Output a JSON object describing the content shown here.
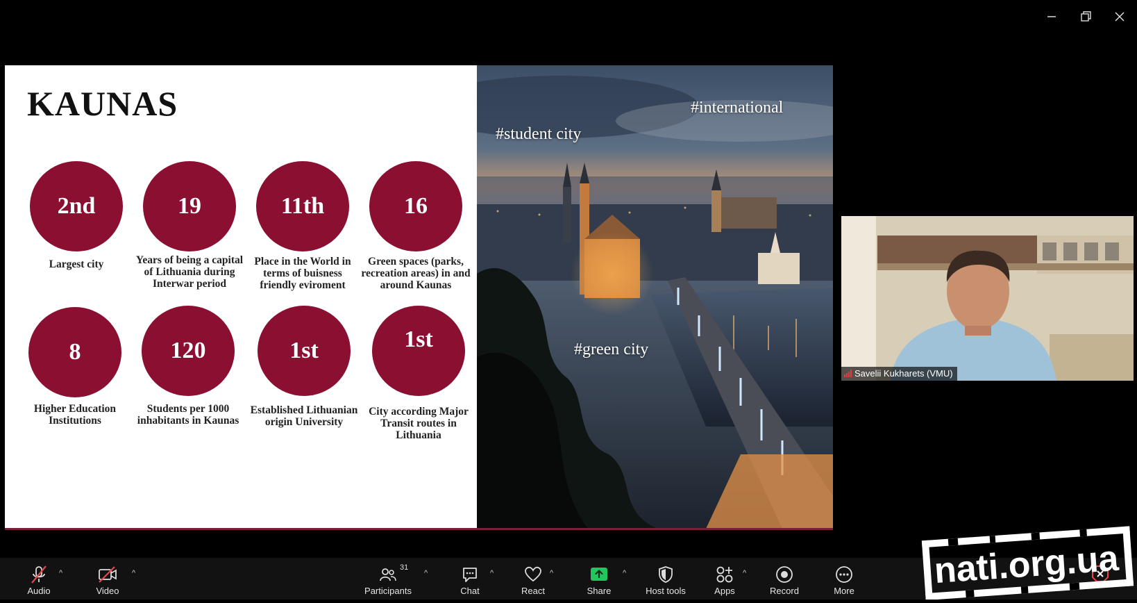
{
  "slide": {
    "title": "KAUNAS",
    "stats": [
      {
        "value": "2nd",
        "caption": "Largest city"
      },
      {
        "value": "19",
        "caption": "Years of being a capital of Lithuania during Interwar period"
      },
      {
        "value": "11th",
        "caption": "Place in the World in terms of buisness friendly eviroment"
      },
      {
        "value": "16",
        "caption": "Green spaces (parks, recreation areas) in and around Kaunas"
      },
      {
        "value": "8",
        "caption": "Higher Education Institutions"
      },
      {
        "value": "120",
        "caption": "Students per 1000  inhabitants in Kaunas"
      },
      {
        "value": "1st",
        "caption": "Established Lithuanian origin University"
      },
      {
        "value": "1st",
        "caption": "City according Major Transit routes in Lithuania"
      }
    ],
    "tags": {
      "international": "#international",
      "student_city": "#student city",
      "green_city": "#green city"
    },
    "accent_color": "#8a0f31"
  },
  "participant": {
    "name": "Savelii Kukharets (VMU)"
  },
  "toolbar": {
    "audio": "Audio",
    "video": "Video",
    "participants": "Participants",
    "participant_count": "31",
    "chat": "Chat",
    "react": "React",
    "share": "Share",
    "host_tools": "Host tools",
    "apps": "Apps",
    "record": "Record",
    "more": "More"
  },
  "watermark": {
    "text": "nati.org.ua"
  }
}
